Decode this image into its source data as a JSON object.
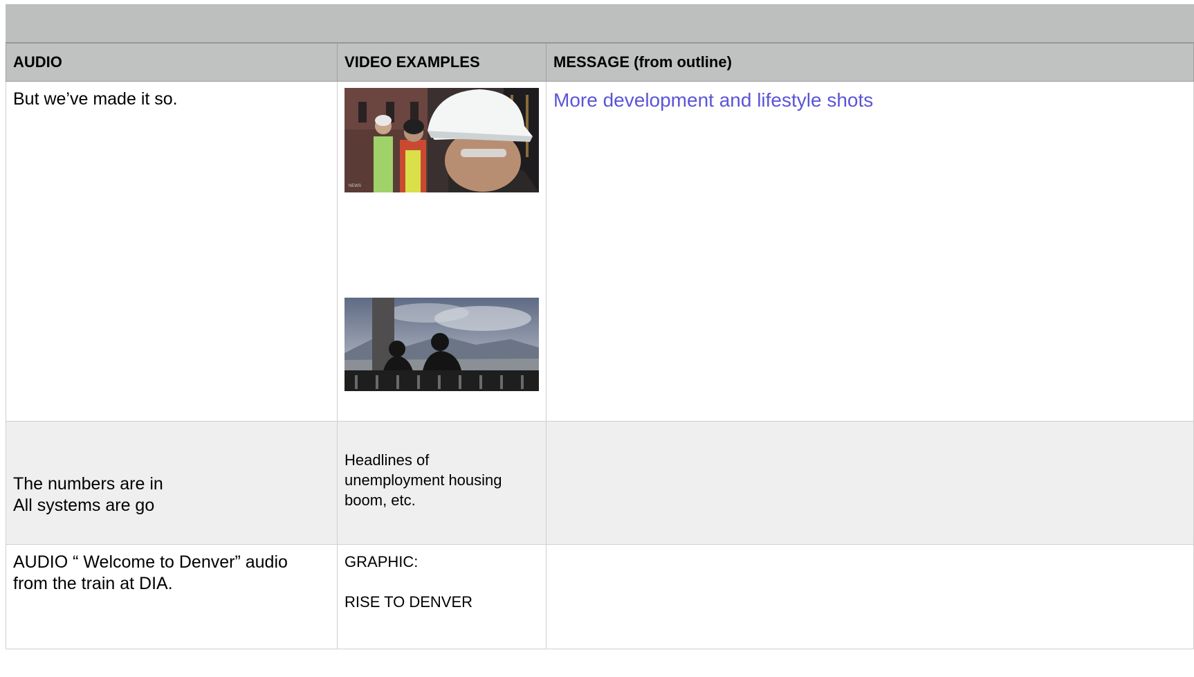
{
  "header": {
    "col_audio": "AUDIO",
    "col_video": "VIDEO EXAMPLES",
    "col_message": "MESSAGE (from outline)"
  },
  "rows": [
    {
      "audio": "But we’ve made it so.",
      "video_images": [
        "construction-workers-hardhats-image",
        "couple-on-bench-mountains-image"
      ],
      "message": "More development and lifestyle shots"
    },
    {
      "audio_lines": [
        "The numbers are in",
        "All systems are go"
      ],
      "video_lines": [
        "Headlines of",
        "unemployment housing",
        "boom, etc."
      ],
      "message": ""
    },
    {
      "audio_lines": [
        "AUDIO “ Welcome to Denver” audio",
        "from the train at DIA."
      ],
      "video_lines": [
        "GRAPHIC:",
        "",
        "RISE TO DENVER"
      ],
      "message": ""
    }
  ],
  "colors": {
    "header_band": "#bdbfbe",
    "link_text": "#5a55d6",
    "alt_row": "#efefef"
  }
}
